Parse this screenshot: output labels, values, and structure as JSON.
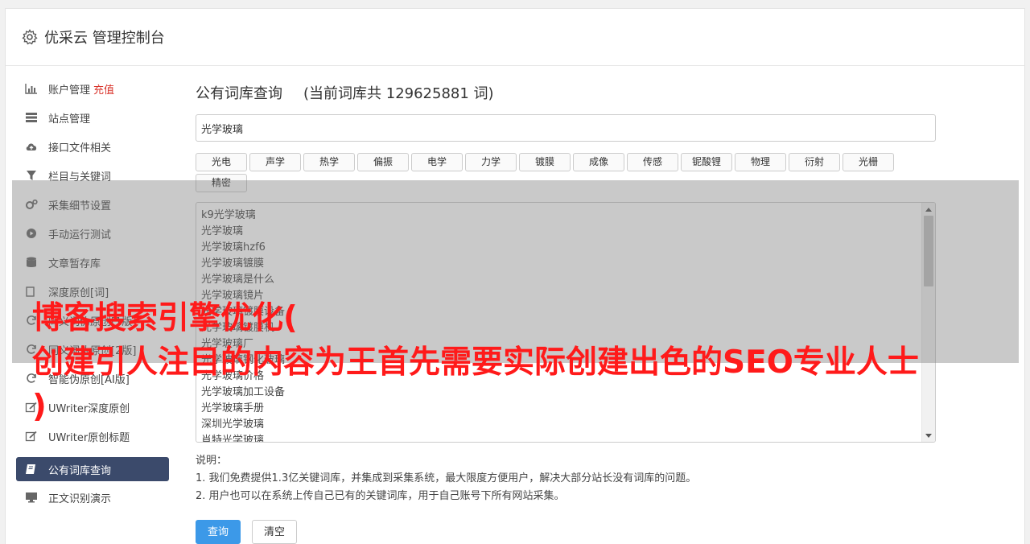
{
  "header": {
    "title": "优采云 管理控制台"
  },
  "sidebar": {
    "items": [
      {
        "label": "账户管理",
        "accent": "充值",
        "icon": "bar-chart-icon"
      },
      {
        "label": "站点管理",
        "icon": "server-icon"
      },
      {
        "label": "接口文件相关",
        "icon": "cloud-upload-icon"
      },
      {
        "label": "栏目与关键词",
        "icon": "filter-icon"
      },
      {
        "label": "采集细节设置",
        "icon": "gears-icon"
      },
      {
        "label": "手动运行测试",
        "icon": "play-circle-icon"
      },
      {
        "label": "文章暂存库",
        "icon": "database-icon"
      },
      {
        "label": "深度原创[词]",
        "icon": "copy-icon"
      },
      {
        "label": "同义词伪原创[1版]",
        "icon": "refresh-icon"
      },
      {
        "label": "同义词伪原创[2版]",
        "icon": "refresh-icon"
      },
      {
        "label": "智能伪原创[AI版]",
        "icon": "refresh-icon"
      },
      {
        "label": "UWriter深度原创",
        "icon": "edit-icon"
      },
      {
        "label": "UWriter原创标题",
        "icon": "edit-icon"
      },
      {
        "label": "公有词库查询",
        "icon": "book-icon",
        "active": true
      },
      {
        "label": "正文识别演示",
        "icon": "monitor-icon"
      }
    ]
  },
  "main": {
    "title": "公有词库查询",
    "count_text": "(当前词库共 129625881 词)",
    "search_value": "光学玻璃",
    "tags": [
      "光电",
      "声学",
      "热学",
      "偏振",
      "电学",
      "力学",
      "镀膜",
      "成像",
      "传感",
      "铌酸锂",
      "物理",
      "衍射",
      "光栅",
      "精密"
    ],
    "results": [
      "k9光学玻璃",
      "光学玻璃",
      "光学玻璃hzf6",
      "光学玻璃镀膜",
      "光学玻璃是什么",
      "光学玻璃镜片",
      "光学玻璃镀膜设备",
      "光学玻璃镀膜机",
      "光学玻璃厂",
      "光学玻璃钢化玻璃",
      "光学玻璃价格",
      "光学玻璃加工设备",
      "光学玻璃手册",
      "深圳光学玻璃",
      "肖特光学玻璃"
    ],
    "notes": {
      "heading": "说明：",
      "lines": [
        "1. 我们免费提供1.3亿关键词库，并集成到采集系统，最大限度方便用户，解决大部分站长没有词库的问题。",
        "2. 用户也可以在系统上传自己已有的关键词库，用于自己账号下所有网站采集。"
      ]
    },
    "buttons": {
      "query": "查询",
      "clear": "清空"
    }
  },
  "watermark": {
    "line1": "博客搜索引擎优化(",
    "line2": "创建引人注目的内容为王首先需要实际创建出色的SEO专业人士",
    "line3": ")"
  },
  "colors": {
    "accent": "#d9342b",
    "active_bg": "#3b4a6b",
    "primary": "#3c99e8",
    "watermark": "#ff1a1a"
  }
}
